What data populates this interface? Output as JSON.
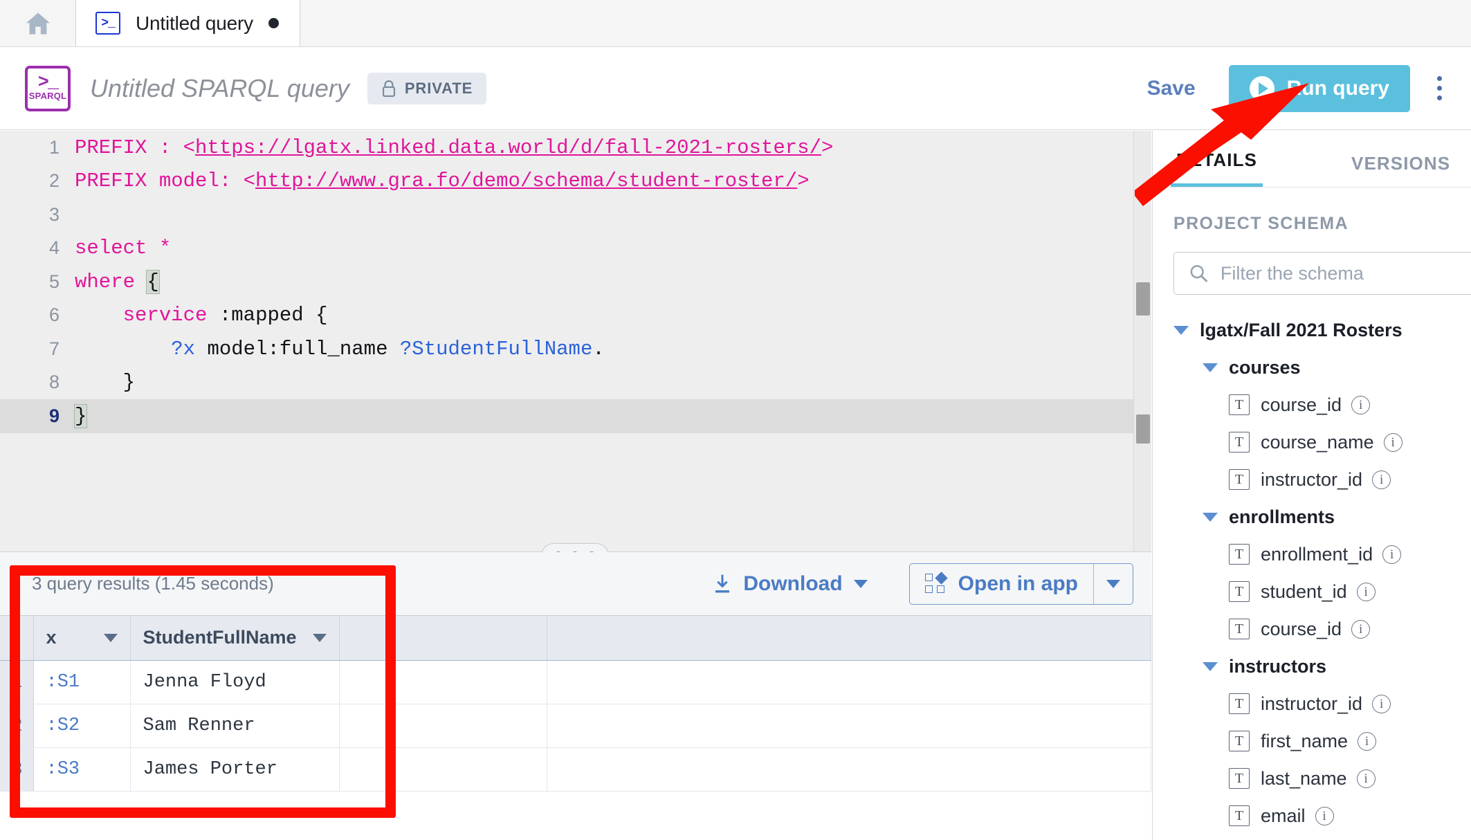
{
  "tabstrip": {
    "home_icon": "home-icon",
    "tab": {
      "icon": ">_",
      "label": "Untitled query",
      "unsaved_dot": "●"
    }
  },
  "query_header": {
    "logo_top": ">_",
    "logo_label": "SPARQL",
    "title": "Untitled SPARQL query",
    "privacy_badge": {
      "icon": "lock-icon",
      "label": "PRIVATE"
    },
    "save_label": "Save",
    "run_label": "Run query",
    "more_label": "more-options",
    "accent_run": "#5bc0de",
    "accent_link": "#4a7cc4"
  },
  "editor": {
    "lines": [
      {
        "n": "1",
        "tokens": [
          {
            "t": "PREFIX : <",
            "c": "k-prefix"
          },
          {
            "t": "https://lgatx.linked.data.world/d/fall-2021-rosters/",
            "c": "k-url"
          },
          {
            "t": ">",
            "c": "k-prefix"
          }
        ]
      },
      {
        "n": "2",
        "tokens": [
          {
            "t": "PREFIX model: <",
            "c": "k-prefix"
          },
          {
            "t": "http://www.gra.fo/demo/schema/student-roster/",
            "c": "k-url"
          },
          {
            "t": ">",
            "c": "k-prefix"
          }
        ]
      },
      {
        "n": "3",
        "tokens": []
      },
      {
        "n": "4",
        "tokens": [
          {
            "t": "select *",
            "c": "k-prefix"
          }
        ]
      },
      {
        "n": "5",
        "tokens": [
          {
            "t": "where ",
            "c": "k-prefix"
          },
          {
            "t": "{",
            "c": "k-punct brmatch"
          }
        ]
      },
      {
        "n": "6",
        "tokens": [
          {
            "t": "    ",
            "c": "k-plain"
          },
          {
            "t": "service ",
            "c": "k-prefix"
          },
          {
            "t": ":mapped {",
            "c": "k-plain"
          }
        ]
      },
      {
        "n": "7",
        "tokens": [
          {
            "t": "        ",
            "c": "k-plain"
          },
          {
            "t": "?x",
            "c": "k-var"
          },
          {
            "t": " model:full_name ",
            "c": "k-plain"
          },
          {
            "t": "?StudentFullName",
            "c": "k-var"
          },
          {
            "t": ".",
            "c": "k-plain"
          }
        ]
      },
      {
        "n": "8",
        "tokens": [
          {
            "t": "    }",
            "c": "k-plain"
          }
        ]
      },
      {
        "n": "9",
        "active": true,
        "tokens": [
          {
            "t": "}",
            "c": "k-plain brmatch"
          }
        ]
      }
    ]
  },
  "results": {
    "count_text": "3 query results (1.45 seconds)",
    "download_label": "Download",
    "download_icon": "download-icon",
    "open_in_app_label": "Open in app",
    "open_in_app_icon": "apps-grid-icon",
    "columns": [
      "x",
      "StudentFullName"
    ],
    "rows": [
      {
        "num": "1",
        "x": ":S1",
        "name": "Jenna Floyd"
      },
      {
        "num": "2",
        "x": ":S2",
        "name": "Sam Renner"
      },
      {
        "num": "3",
        "x": ":S3",
        "name": "James Porter"
      }
    ]
  },
  "sidebar": {
    "tabs": [
      {
        "label": "DETAILS",
        "active": true
      },
      {
        "label": "VERSIONS",
        "active": false
      }
    ],
    "schema_heading": "PROJECT SCHEMA",
    "filter_placeholder": "Filter the schema",
    "filter_value": "",
    "filter_icon": "search-icon",
    "tree": [
      {
        "level": 0,
        "type": "group",
        "label": "lgatx/Fall 2021 Rosters"
      },
      {
        "level": 1,
        "type": "group",
        "label": "courses"
      },
      {
        "level": 2,
        "type": "field",
        "label": "course_id"
      },
      {
        "level": 2,
        "type": "field",
        "label": "course_name"
      },
      {
        "level": 2,
        "type": "field",
        "label": "instructor_id"
      },
      {
        "level": 1,
        "type": "group",
        "label": "enrollments"
      },
      {
        "level": 2,
        "type": "field",
        "label": "enrollment_id"
      },
      {
        "level": 2,
        "type": "field",
        "label": "student_id"
      },
      {
        "level": 2,
        "type": "field",
        "label": "course_id"
      },
      {
        "level": 1,
        "type": "group",
        "label": "instructors"
      },
      {
        "level": 2,
        "type": "field",
        "label": "instructor_id"
      },
      {
        "level": 2,
        "type": "field",
        "label": "first_name"
      },
      {
        "level": 2,
        "type": "field",
        "label": "last_name"
      },
      {
        "level": 2,
        "type": "field",
        "label": "email"
      }
    ],
    "field_type_glyph": "T",
    "info_glyph": "i"
  },
  "annotations": {
    "highlight_color": "#fa0f00",
    "arrow_name": "red-arrow-pointing-to-run-query",
    "box_name": "red-box-around-query-results"
  }
}
